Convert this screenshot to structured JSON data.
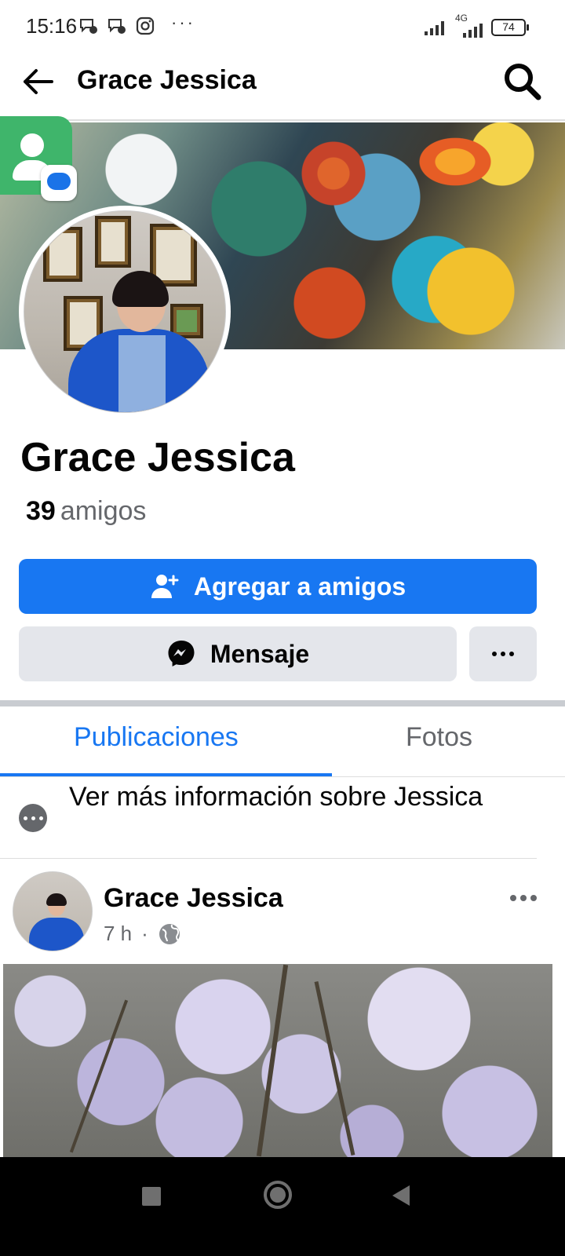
{
  "status_bar": {
    "time": "15:16",
    "battery": "74",
    "network": "4G",
    "more": "···"
  },
  "header": {
    "title": "Grace Jessica"
  },
  "profile": {
    "name": "Grace Jessica",
    "friends_count": "39",
    "friends_label": "amigos"
  },
  "actions": {
    "add_friend_label": "Agregar a amigos",
    "message_label": "Mensaje"
  },
  "tabs": [
    {
      "label": "Publicaciones",
      "active": true
    },
    {
      "label": "Fotos",
      "active": false
    }
  ],
  "about": {
    "text": "Ver más información sobre Jessica"
  },
  "post": {
    "author": "Grace Jessica",
    "time": "7 h",
    "separator": "·"
  },
  "colors": {
    "primary": "#1877f2",
    "secondary_button": "#e4e6eb",
    "muted_text": "#65676b"
  }
}
